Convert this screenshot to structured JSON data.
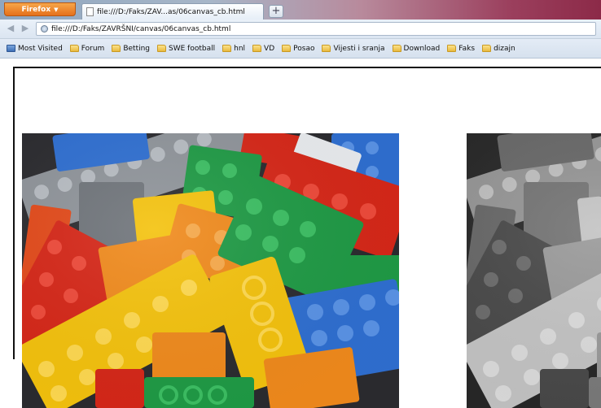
{
  "browser": {
    "menu_button": "Firefox",
    "tab_title": "file:///D:/Faks/ZAV...as/06canvas_cb.html",
    "new_tab_symbol": "+",
    "url": "file:///D:/Faks/ZAVRŠNI/canvas/06canvas_cb.html"
  },
  "bookmarks": [
    {
      "label": "Most Visited",
      "icon": "most-visited-icon"
    },
    {
      "label": "Forum",
      "icon": "folder-icon"
    },
    {
      "label": "Betting",
      "icon": "folder-icon"
    },
    {
      "label": "SWE football",
      "icon": "folder-icon"
    },
    {
      "label": "hnl",
      "icon": "folder-icon"
    },
    {
      "label": "VD",
      "icon": "folder-icon"
    },
    {
      "label": "Posao",
      "icon": "folder-icon"
    },
    {
      "label": "Vijesti i sranja",
      "icon": "folder-icon"
    },
    {
      "label": "Download",
      "icon": "folder-icon"
    },
    {
      "label": "Faks",
      "icon": "folder-icon"
    },
    {
      "label": "dizajn",
      "icon": "folder-icon"
    }
  ],
  "page": {
    "images": [
      {
        "name": "lego-color-image",
        "mode": "color"
      },
      {
        "name": "lego-grayscale-image",
        "mode": "grayscale"
      }
    ]
  },
  "colors": {
    "lego_red": "#d62718",
    "lego_yellow": "#f4c20d",
    "lego_green": "#1f9a45",
    "lego_blue": "#2f6fd1",
    "lego_orange": "#f08a1c",
    "lego_gray": "#8a8f96",
    "lego_white": "#e9ecef"
  }
}
